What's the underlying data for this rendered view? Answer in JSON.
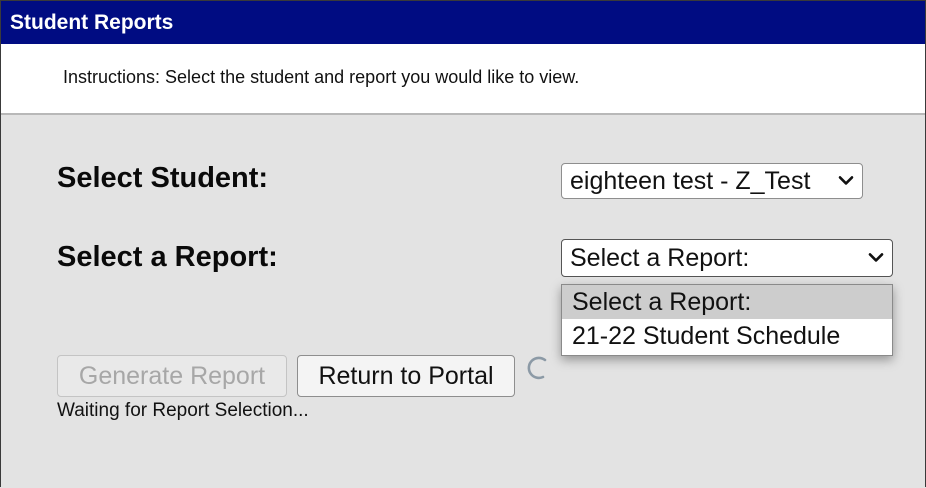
{
  "window": {
    "title": "Student Reports"
  },
  "instructions": "Instructions: Select the student and report you would like to view.",
  "form": {
    "student_label": "Select Student:",
    "student_selected": "eighteen test - Z_Test",
    "report_label": "Select a Report:",
    "report_selected": "Select a Report:",
    "report_options": [
      "Select a Report:",
      "21-22 Student Schedule"
    ]
  },
  "buttons": {
    "generate_label": "Generate Report",
    "return_label": "Return to Portal"
  },
  "status": "Waiting for Report Selection...",
  "colors": {
    "titlebar": "#000c82",
    "background": "#e3e3e3",
    "highlight": "#cdcdcd"
  },
  "icons": {
    "select_arrow": "chevron-down-icon",
    "loading": "spinner-icon"
  }
}
